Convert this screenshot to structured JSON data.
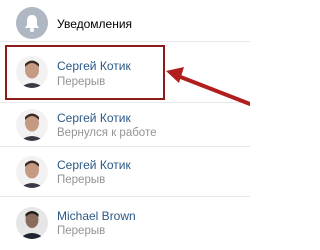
{
  "notifications": {
    "label": "Уведомления",
    "icon": "bell-icon"
  },
  "contacts": [
    {
      "name": "Сергей Котик",
      "status": "Перерыв"
    },
    {
      "name": "Сергей Котик",
      "status": "Вернулся к работе"
    },
    {
      "name": "Сергей Котик",
      "status": "Перерыв"
    },
    {
      "name": "Michael Brown",
      "status": "Перерыв"
    }
  ],
  "colors": {
    "link": "#2a5885",
    "secondary": "#939393",
    "divider": "#e7e8ec",
    "annotation": "#b01e1e"
  }
}
